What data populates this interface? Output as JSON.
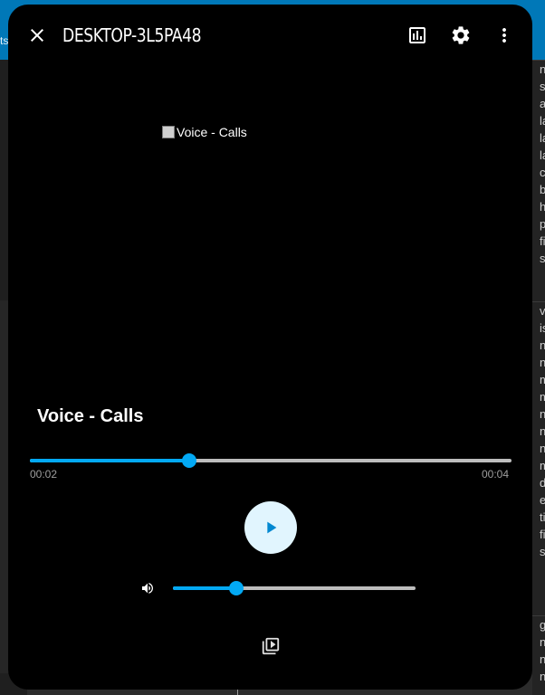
{
  "background": {
    "topbar_text": "ts",
    "right_column_letters": {
      "group1": [
        "n",
        "s",
        "a",
        "la",
        "la",
        "la",
        "c",
        "b",
        "h",
        "p",
        "fi",
        "s"
      ],
      "group2": [
        "v",
        "is",
        "n",
        "n",
        "m",
        "m",
        "n",
        "n",
        "n",
        "m",
        "d",
        "e",
        "ti",
        "fi",
        "s"
      ],
      "group3": [
        "g",
        "n",
        "n",
        "n"
      ]
    }
  },
  "dialog": {
    "title": "DESKTOP-3L5PA48",
    "icons": {
      "close": "close-icon",
      "stats": "chart-icon",
      "settings": "gear-icon",
      "menu": "more-vertical-icon"
    }
  },
  "media": {
    "artwork_alt": "Voice - Calls",
    "title": "Voice - Calls",
    "current_time": "00:02",
    "duration": "00:04",
    "progress_fraction": 0.33,
    "volume_fraction": 0.26,
    "play_icon": "play-icon",
    "volume_icon": "volume-icon",
    "browse_icon": "media-library-icon"
  },
  "colors": {
    "accent": "#03a9f4",
    "play_button_bg": "#e1f5fe",
    "dialog_bg": "#000000",
    "topbar": "#0078b8"
  }
}
